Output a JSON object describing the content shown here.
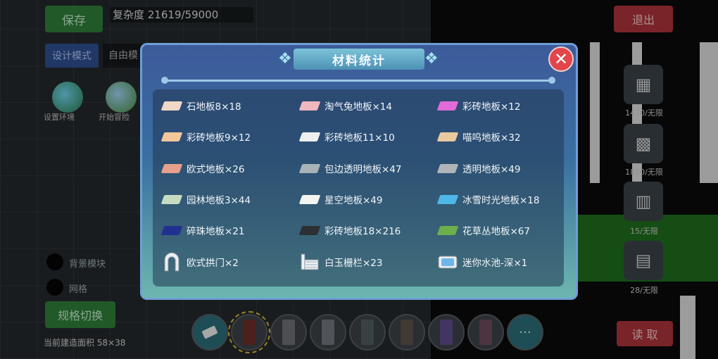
{
  "hud": {
    "save_label": "保存",
    "complexity_text": "复杂度 21619/59000",
    "exit_label": "退出",
    "design_mode_label": "设计模式",
    "free_mode_label": "自由模",
    "orb_labels": [
      "设置环境",
      "开始冒险"
    ],
    "toggle_labels": [
      "背景模块",
      "网格"
    ],
    "spec_switch_label": "规格切换",
    "size_text": "当前建造面积 58×38",
    "read_label": "读 取",
    "right_tiles": [
      {
        "icon": "▦",
        "label": "1470/无限"
      },
      {
        "icon": "▩",
        "label": "1820/无限"
      },
      {
        "icon": "▥",
        "label": "15/无限"
      },
      {
        "icon": "▤",
        "label": "28/无限"
      }
    ]
  },
  "hotbar": {
    "more_label": "···",
    "slot_colors": [
      "#6a2d26",
      "#6b6e72",
      "#70747a",
      "#4f5a5e",
      "#5a5148",
      "#5b4a8a",
      "#6a4a5a"
    ]
  },
  "dialog": {
    "title": "材料统计",
    "close_label": "✕",
    "items": [
      {
        "label": "石地板8×18",
        "icon": "floor-tile",
        "color": "#f1d8c6"
      },
      {
        "label": "淘气兔地板×14",
        "icon": "floor-tile",
        "color": "#f1b7bf"
      },
      {
        "label": "彩砖地板×12",
        "icon": "floor-tile",
        "color": "#e26ad8"
      },
      {
        "label": "彩砖地板9×12",
        "icon": "floor-tile",
        "color": "#f3c79c"
      },
      {
        "label": "彩砖地板11×10",
        "icon": "floor-tile",
        "color": "#eef0ef"
      },
      {
        "label": "喵呜地板×32",
        "icon": "floor-tile",
        "color": "#e9c9a0"
      },
      {
        "label": "欧式地板×26",
        "icon": "floor-tile",
        "color": "#e7a08b"
      },
      {
        "label": "包边透明地板×47",
        "icon": "floor-tile",
        "color": "#a8b2b7"
      },
      {
        "label": "透明地板×49",
        "icon": "floor-tile",
        "color": "#aeb4b8"
      },
      {
        "label": "园林地板3×44",
        "icon": "floor-tile",
        "color": "#c6dcc2"
      },
      {
        "label": "星空地板×49",
        "icon": "floor-tile",
        "color": "#f4f4f0"
      },
      {
        "label": "冰雪时光地板×18",
        "icon": "floor-tile",
        "color": "#4fb7e8"
      },
      {
        "label": "碎珠地板×21",
        "icon": "floor-tile",
        "color": "#22308f"
      },
      {
        "label": "彩砖地板18×216",
        "icon": "floor-tile",
        "color": "#2c2f33"
      },
      {
        "label": "花草丛地板×67",
        "icon": "floor-tile",
        "color": "#6bb04a"
      },
      {
        "label": "欧式拱门×2",
        "icon": "arch-door-icon",
        "color": "#e8eef2"
      },
      {
        "label": "白玉栅栏×23",
        "icon": "fence-icon",
        "color": "#eef2f4"
      },
      {
        "label": "迷你水池-深×1",
        "icon": "pool-icon",
        "color": "#6fb6e8"
      }
    ]
  }
}
